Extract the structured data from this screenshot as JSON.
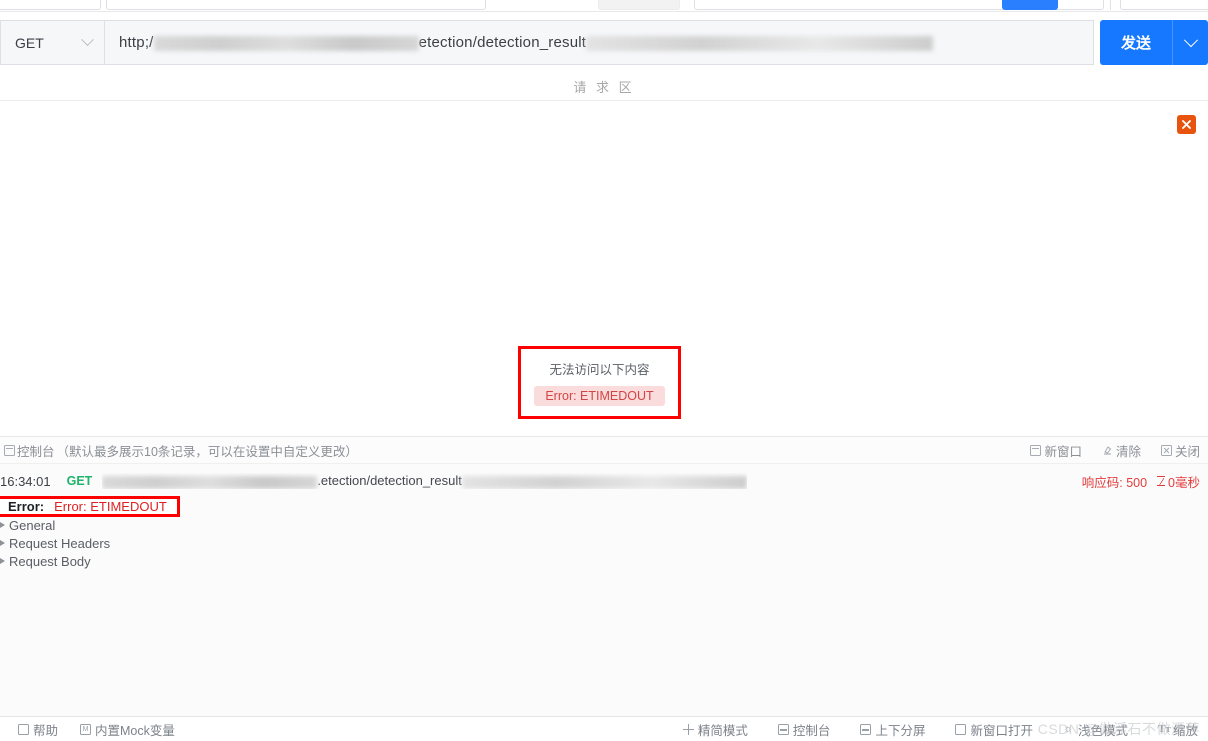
{
  "request": {
    "method": "GET",
    "url_visible_prefix": "http;/",
    "url_visible_middle": "etection/detection_result",
    "send_label": "发送",
    "area_label": "请 求 区"
  },
  "response": {
    "error_title": "无法访问以下内容",
    "error_badge": "Error: ETIMEDOUT",
    "close_icon": "close-icon"
  },
  "console": {
    "title": "控制台",
    "hint": "（默认最多展示10条记录，可以在设置中自定义更改）",
    "actions": [
      {
        "label": "新窗口",
        "icon": "new-window-icon"
      },
      {
        "label": "清除",
        "icon": "clear-icon"
      },
      {
        "label": "关闭",
        "icon": "close-icon"
      }
    ],
    "log": {
      "time": "16:34:01",
      "method": "GET",
      "url_visible": ".etection/detection_result",
      "status_label": "响应码:",
      "status_code": "500",
      "duration": "0毫秒"
    },
    "error_row": {
      "label": "Error:",
      "value": "Error: ETIMEDOUT"
    },
    "tree": [
      {
        "label": "General"
      },
      {
        "label": "Request Headers"
      },
      {
        "label": "Request Body"
      }
    ]
  },
  "bottom_bar": {
    "left": [
      {
        "label": "帮助",
        "icon": "help-icon"
      },
      {
        "label": "内置Mock变量",
        "icon": "mock-icon"
      }
    ],
    "right": [
      {
        "label": "精简模式",
        "icon": "compact-mode-icon"
      },
      {
        "label": "控制台",
        "icon": "console-icon"
      },
      {
        "label": "上下分屏",
        "icon": "split-screen-icon"
      },
      {
        "label": "新窗口打开",
        "icon": "new-window-icon"
      },
      {
        "label": "浅色模式",
        "icon": "sun-icon"
      },
      {
        "label": "缩放",
        "icon": "text-size-icon"
      }
    ]
  },
  "watermark": {
    "text": "CSDN @做浮石不做漂萍"
  }
}
